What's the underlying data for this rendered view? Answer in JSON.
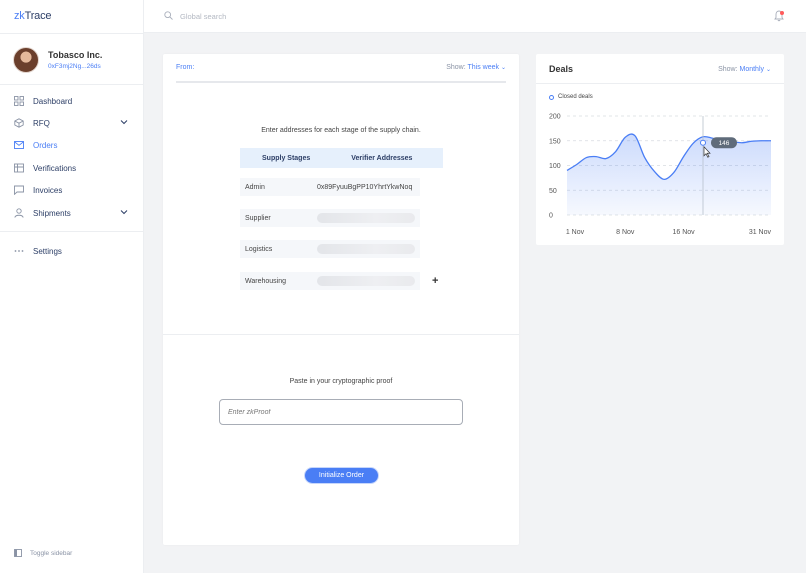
{
  "app": {
    "logo_prefix": "zk",
    "logo_suffix": "Trace"
  },
  "user": {
    "company": "Tobasco Inc.",
    "address": "0xF3mj2Ng...26ds"
  },
  "sidebar": {
    "items": [
      {
        "label": "Dashboard",
        "icon": "grid-icon"
      },
      {
        "label": "RFQ",
        "icon": "box-icon",
        "expandable": true
      },
      {
        "label": "Orders",
        "icon": "mail-icon",
        "active": true
      },
      {
        "label": "Verifications",
        "icon": "table-icon"
      },
      {
        "label": "Invoices",
        "icon": "chat-icon"
      },
      {
        "label": "Shipments",
        "icon": "person-icon",
        "expandable": true
      },
      {
        "label": "Settings",
        "icon": "dots-icon"
      }
    ],
    "toggle_label": "Toggle sidebar"
  },
  "topbar": {
    "search_placeholder": "Global search",
    "notification_dot": true
  },
  "order": {
    "from_label": "From:",
    "show_prefix": "Show:",
    "show_value": "This week",
    "instructions": "Enter addresses for each stage of the supply chain.",
    "col_stages": "Supply Stages",
    "col_verifiers": "Verifier Addresses",
    "rows": [
      {
        "stage": "Admin",
        "address": "0x89FyuuBgPP10YhrtYkwNoq"
      },
      {
        "stage": "Supplier",
        "address": ""
      },
      {
        "stage": "Logistics",
        "address": ""
      },
      {
        "stage": "Warehousing",
        "address": ""
      }
    ],
    "add_symbol": "+",
    "proof_label": "Paste in your cryptographic proof",
    "proof_placeholder": "Enter zkProof",
    "init_button": "Initialize Order"
  },
  "deals": {
    "title": "Deals",
    "show_prefix": "Show:",
    "show_value": "Monthly",
    "legend": "Closed deals",
    "tooltip": "146"
  },
  "chart_data": {
    "type": "area",
    "series": [
      {
        "name": "Closed deals",
        "x": [
          0,
          1,
          2,
          3,
          4,
          5,
          6,
          7,
          8,
          9,
          10,
          11,
          12,
          13,
          14,
          15,
          16,
          17,
          18,
          19,
          20,
          21
        ],
        "values": [
          90,
          102,
          116,
          118,
          114,
          128,
          157,
          160,
          116,
          88,
          72,
          86,
          118,
          145,
          158,
          155,
          150,
          148,
          146,
          149,
          150,
          150
        ]
      }
    ],
    "x_tick_labels": [
      "1 Nov",
      "8 Nov",
      "16 Nov",
      "31 Nov"
    ],
    "x_tick_positions": [
      0,
      6,
      12,
      21
    ],
    "y_ticks": [
      0,
      50,
      100,
      150,
      200
    ],
    "ylim": [
      0,
      200
    ],
    "highlight_x": 14,
    "highlight_value": 146,
    "grid": true,
    "color": "#4a7ef5"
  }
}
